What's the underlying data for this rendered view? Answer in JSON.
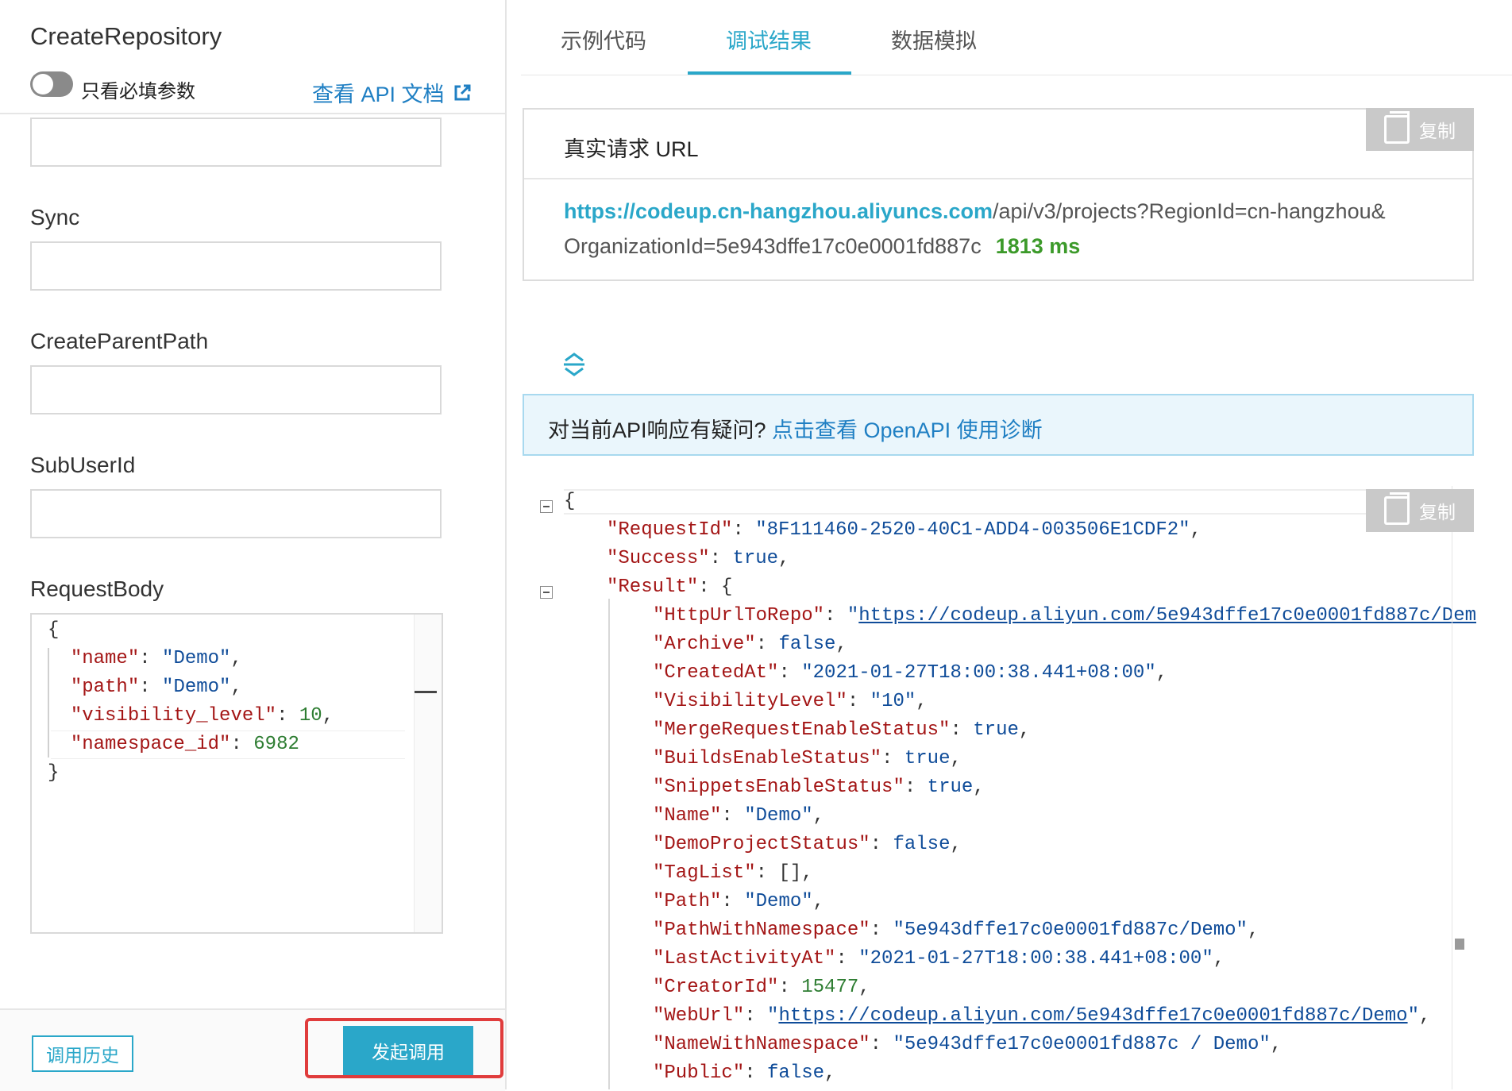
{
  "left": {
    "api_name": "CreateRepository",
    "toggle_label": "只看必填参数",
    "doc_link": "查看 API 文档",
    "fields": [
      {
        "label": "Sync",
        "value": ""
      },
      {
        "label": "CreateParentPath",
        "value": ""
      },
      {
        "label": "SubUserId",
        "value": ""
      },
      {
        "label": "RequestBody"
      }
    ],
    "request_body_lines": [
      "{",
      "  \"name\": \"Demo\",",
      "  \"path\": \"Demo\",",
      "  \"visibility_level\": 10,",
      "  \"namespace_id\": 6982",
      "}"
    ],
    "history_button": "调用历史",
    "invoke_button": "发起调用"
  },
  "right": {
    "tabs": [
      "示例代码",
      "调试结果",
      "数据模拟"
    ],
    "active_tab": "调试结果",
    "url_title": "真实请求 URL",
    "copy_label": "复制",
    "url_host": "https://codeup.cn-hangzhou.aliyuncs.com",
    "url_path": "/api/v3/projects?RegionId=cn-hangzhou&",
    "url_line2": "OrganizationId=5e943dffe17c0e0001fd887c",
    "latency": "1813 ms",
    "diag_question": "对当前API响应有疑问? ",
    "diag_link": "点击查看 OpenAPI 使用诊断"
  },
  "response": {
    "RequestId": "8F111460-2520-40C1-ADD4-003506E1CDF2",
    "Success": "true",
    "Result": {
      "HttpUrlToRepo": "https://codeup.aliyun.com/5e943dffe17c0e0001fd887c/Dem",
      "Archive": "false",
      "CreatedAt": "2021-01-27T18:00:38.441+08:00",
      "VisibilityLevel": "10",
      "MergeRequestEnableStatus": "true",
      "BuildsEnableStatus": "true",
      "SnippetsEnableStatus": "true",
      "Name": "Demo",
      "DemoProjectStatus": "false",
      "TagList": "[]",
      "Path": "Demo",
      "PathWithNamespace": "5e943dffe17c0e0001fd887c/Demo",
      "LastActivityAt": "2021-01-27T18:00:38.441+08:00",
      "CreatorId": "15477",
      "WebUrl": "https://codeup.aliyun.com/5e943dffe17c0e0001fd887c/Demo",
      "NameWithNamespace": "5e943dffe17c0e0001fd887c / Demo",
      "Public": "false"
    }
  },
  "colors": {
    "accent": "#2aa7c9",
    "highlight_border": "#e03c3c",
    "latency_green": "#3c9a2a",
    "link_blue": "#1f7fc3"
  }
}
